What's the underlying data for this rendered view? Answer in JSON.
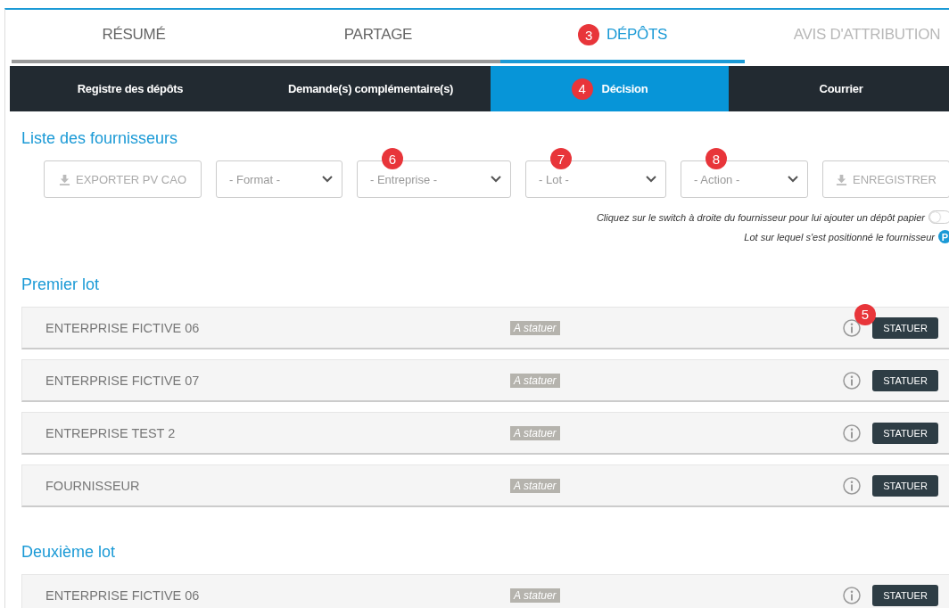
{
  "tabs": [
    {
      "label": "RÉSUMÉ",
      "selected": false,
      "disabled": false
    },
    {
      "label": "PARTAGE",
      "selected": false,
      "disabled": false
    },
    {
      "label": "DÉPÔTS",
      "selected": true,
      "disabled": false,
      "badge": "3"
    },
    {
      "label": "AVIS D'ATTRIBUTION",
      "selected": false,
      "disabled": true
    }
  ],
  "subtabs": [
    {
      "label": "Registre des dépôts",
      "selected": false
    },
    {
      "label": "Demande(s) complémentaire(s)",
      "selected": false
    },
    {
      "label": "Décision",
      "selected": true,
      "badge": "4"
    },
    {
      "label": "Courrier",
      "selected": false
    }
  ],
  "section_title": "Liste des fournisseurs",
  "toolbar": [
    {
      "kind": "button",
      "label": "EXPORTER PV CAO"
    },
    {
      "kind": "select",
      "label": "- Format -"
    },
    {
      "kind": "select",
      "label": "- Entreprise -",
      "badge": "6"
    },
    {
      "kind": "select",
      "label": "- Lot -",
      "badge": "7"
    },
    {
      "kind": "select",
      "label": "- Action -",
      "badge": "8"
    },
    {
      "kind": "button",
      "label": "ENREGISTRER"
    }
  ],
  "legend": [
    {
      "text": "Cliquez sur le switch à droite du fournisseur pour lui ajouter un dépôt papier",
      "kind": "switch"
    },
    {
      "text": "Lot sur lequel s'est positionné le fournisseur",
      "kind": "p",
      "mark": "P"
    }
  ],
  "lots": [
    {
      "title": "Premier lot",
      "rows": [
        {
          "name": "ENTERPRISE FICTIVE 06",
          "status": "A statuer",
          "action": "STATUER",
          "badge": "5"
        },
        {
          "name": "ENTERPRISE FICTIVE 07",
          "status": "A statuer",
          "action": "STATUER"
        },
        {
          "name": "ENTREPRISE TEST 2",
          "status": "A statuer",
          "action": "STATUER"
        },
        {
          "name": "FOURNISSEUR",
          "status": "A statuer",
          "action": "STATUER"
        }
      ]
    },
    {
      "title": "Deuxième lot",
      "rows": [
        {
          "name": "ENTERPRISE FICTIVE 06",
          "status": "A statuer",
          "action": "STATUER"
        }
      ]
    }
  ]
}
